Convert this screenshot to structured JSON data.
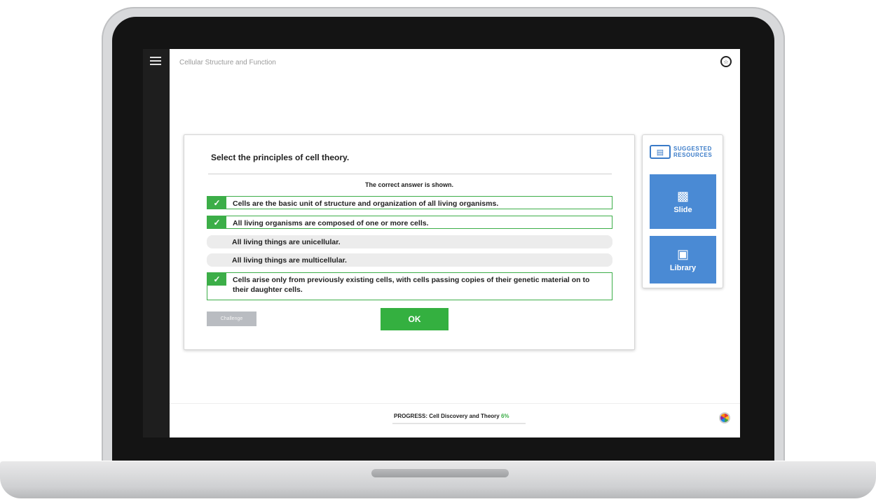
{
  "header": {
    "breadcrumb": "Cellular Structure and Function"
  },
  "question": {
    "prompt": "Select the principles of cell theory.",
    "note": "The correct answer is shown.",
    "options": [
      {
        "text": "Cells are the basic unit of structure and organization of all living organisms.",
        "selected": true
      },
      {
        "text": "All living organisms are composed of one or more cells.",
        "selected": true
      },
      {
        "text": "All living things are unicellular.",
        "selected": false
      },
      {
        "text": "All living things are multicellular.",
        "selected": false
      },
      {
        "text": "Cells arise only from previously existing cells, with cells passing copies of their genetic material on to their daughter cells.",
        "selected": true
      }
    ],
    "challenge_label": "Challenge",
    "ok_label": "OK"
  },
  "resources": {
    "title_line1": "SUGGESTED",
    "title_line2": "RESOURCES",
    "slide_label": "Slide",
    "library_label": "Library"
  },
  "footer": {
    "progress_label": "PROGRESS: Cell Discovery and Theory",
    "progress_value": "6%"
  },
  "colors": {
    "accent_green": "#3cae48",
    "resource_blue": "#4a8ad4",
    "sidebar": "#1e1e1e"
  },
  "icons": {
    "menu": "hamburger-icon",
    "trophy": "trophy-icon",
    "check": "check-icon",
    "resources": "resources-icon",
    "slide": "presenter-icon",
    "library": "book-icon",
    "palette": "color-wheel-icon"
  }
}
